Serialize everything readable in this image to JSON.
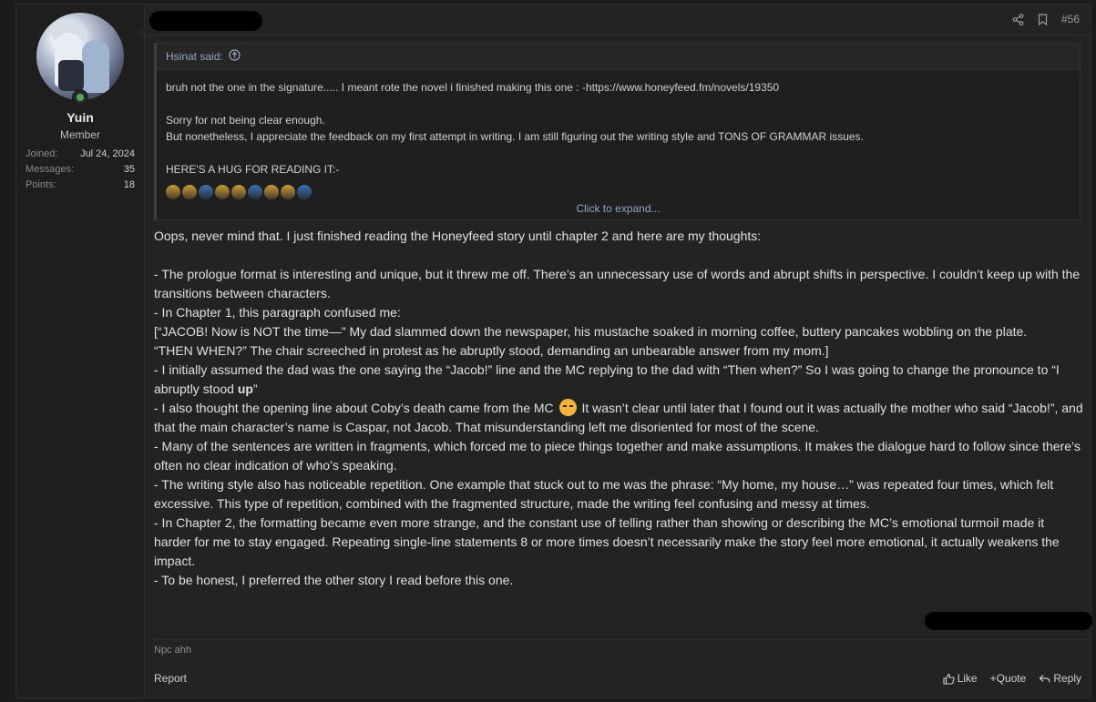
{
  "user": {
    "name": "Yuin",
    "title": "Member",
    "stats": [
      {
        "label": "Joined:",
        "value": "Jul 24, 2024"
      },
      {
        "label": "Messages:",
        "value": "35"
      },
      {
        "label": "Points:",
        "value": "18"
      }
    ]
  },
  "post": {
    "number": "#56",
    "quote": {
      "author": "Hsinat said:",
      "lines": [
        "bruh not the one in the signature..... I meant rote the novel i finished making this one : -https://www.honeyfeed.fm/novels/19350",
        "",
        "Sorry for not being clear enough.",
        "But nonetheless, I appreciate the feedback on my first attempt in writing. I am still figuring out the writing style and TONS OF GRAMMAR issues.",
        "",
        "HERE'S A HUG FOR READING IT:-"
      ],
      "expand_label": "Click to expand..."
    },
    "body": {
      "p1": "Oops, never mind that. I just finished reading the Honeyfeed story until chapter 2 and here are my thoughts:",
      "p2": "- The prologue format is interesting and unique, but it threw me off. There’s an unnecessary use of words and abrupt shifts in perspective. I couldn’t keep up with the transitions between characters.",
      "p3": "- In Chapter 1, this paragraph confused me:",
      "p4": "[“JACOB! Now is NOT the time—” My dad slammed down the newspaper, his mustache soaked in morning coffee, buttery pancakes wobbling on the plate.",
      "p5": "“THEN WHEN?” The chair screeched in protest as he abruptly stood, demanding an unbearable answer from my mom.]",
      "p6a": "- I initially assumed the dad was the one saying the “Jacob!” line and the MC replying to the dad with “Then when?” So I was going to change the pronounce to “I abruptly stood ",
      "p6b": "up",
      "p6c": "”",
      "p7a": "- I also thought the opening line about Coby’s death came from the MC",
      "p7b": " It wasn’t clear until later that I found out it was actually the mother who said “Jacob!”, and that the main character’s name is Caspar, not Jacob. That misunderstanding left me disoriented for most of the scene.",
      "p8": "- Many of the sentences are written in fragments, which forced me to piece things together and make assumptions. It makes the dialogue hard to follow since there’s often no clear indication of who’s speaking.",
      "p9": "- The writing style also has noticeable repetition. One example that stuck out to me was the phrase: “My home, my house…” was repeated four times, which felt excessive. This type of repetition, combined with the fragmented structure, made the writing feel confusing and messy at times.",
      "p10": "- In Chapter 2, the formatting became even more strange, and the constant use of telling rather than showing or describing the MC’s emotional turmoil made it harder for me to stay engaged. Repeating single-line statements 8 or more times doesn’t necessarily make the story feel more emotional, it actually weakens the impact.",
      "p11": "- To be honest, I preferred the other story I read before this one."
    },
    "signature": "Npc ahh",
    "footer": {
      "report": "Report",
      "like": "Like",
      "quote": "+Quote",
      "reply": "Reply"
    }
  },
  "colors": {
    "background": "#1b1b1b",
    "post_bg": "#232323",
    "link": "#93a6bf",
    "online": "#4ea85a"
  }
}
